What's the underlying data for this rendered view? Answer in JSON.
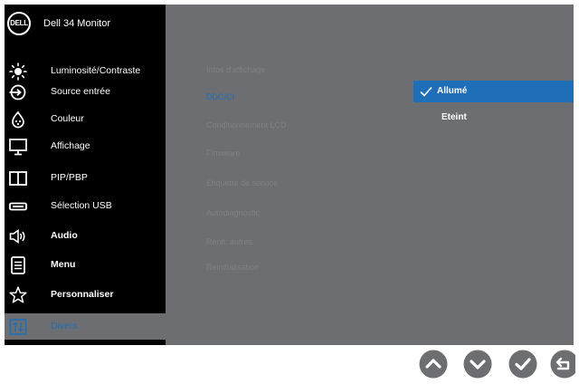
{
  "header": {
    "title": "Dell 34 Monitor",
    "logo_text": "DELL"
  },
  "menu": [
    {
      "label": "Luminosité/Contraste",
      "icon": "brightness-icon",
      "bold": false
    },
    {
      "label": "Source entrée",
      "icon": "input-source-icon",
      "bold": false
    },
    {
      "label": "Couleur",
      "icon": "color-icon",
      "bold": false
    },
    {
      "label": "Affichage",
      "icon": "display-icon",
      "bold": false
    },
    {
      "label": "PIP/PBP",
      "icon": "pip-pbp-icon",
      "bold": false
    },
    {
      "label": "Sélection USB",
      "icon": "usb-icon",
      "bold": false
    },
    {
      "label": "Audio",
      "icon": "audio-icon",
      "bold": true
    },
    {
      "label": "Menu",
      "icon": "menu-icon",
      "bold": true
    },
    {
      "label": "Personnaliser",
      "icon": "star-icon",
      "bold": true
    },
    {
      "label": "Divers",
      "icon": "others-icon",
      "bold": false,
      "selected": true
    }
  ],
  "submenu": [
    {
      "label": "Infos d'affichage"
    },
    {
      "label": "DDC/CI",
      "active": true
    },
    {
      "label": "Conditionnement LCD"
    },
    {
      "label": "Firmware"
    },
    {
      "label": "Étiquette de service"
    },
    {
      "label": "Autodiagnostic"
    },
    {
      "label": "Rénit. autres"
    },
    {
      "label": "Réinitialisation"
    }
  ],
  "options": [
    {
      "label": "Allumé",
      "selected": true
    },
    {
      "label": "Eteint",
      "selected": false
    }
  ],
  "nav_buttons": [
    "up-arrow-icon",
    "down-arrow-icon",
    "check-icon",
    "back-icon"
  ],
  "colors": {
    "accent": "#1f6fb8",
    "panel": "#6d6e71",
    "sidebar": "#000000",
    "dim_text": "#7f8084"
  }
}
